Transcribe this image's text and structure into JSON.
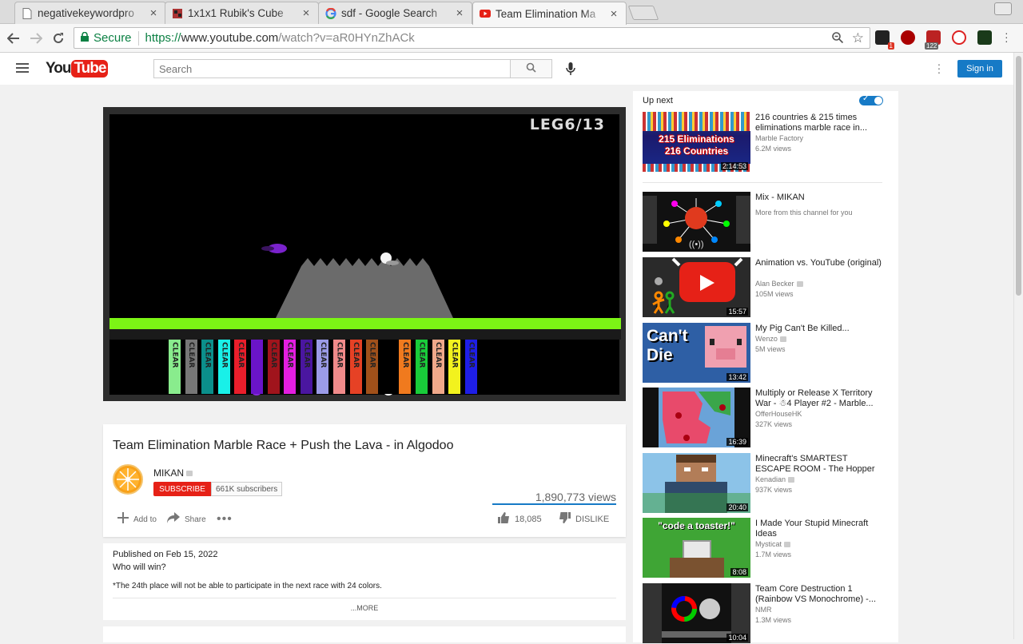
{
  "tabs": [
    {
      "title": "negativekeywordpro",
      "active": false,
      "icon": "document-icon"
    },
    {
      "title": "1x1x1 Rubik's Cube",
      "active": false,
      "icon": "cube-icon"
    },
    {
      "title": "sdf - Google Search",
      "active": false,
      "icon": "google-icon"
    },
    {
      "title": "Team Elimination Ma",
      "active": true,
      "icon": "youtube-icon"
    }
  ],
  "omnibox": {
    "secure": "Secure",
    "protocol": "https://",
    "host": "www.youtube.com",
    "path": "/watch?v=aR0HYnZhACk"
  },
  "extensions": {
    "badge_1": "1",
    "badge_2": "122"
  },
  "youtube": {
    "logo_you": "You",
    "logo_tube": "Tube",
    "search_placeholder": "Search",
    "sign_in": "Sign in"
  },
  "player": {
    "overlay_text": "LEG6/13",
    "tube_label": "CLEAR"
  },
  "video": {
    "title": "Team Elimination Marble Race + Push the Lava - in Algodoo",
    "channel": "MIKAN",
    "subscribe": "SUBSCRIBE",
    "subscribers": "661K subscribers",
    "views": "1,890,773 views",
    "add_to": "Add to",
    "share": "Share",
    "likes": "18,085",
    "dislike": "DISLIKE"
  },
  "description": {
    "published": "Published on Feb 15, 2022",
    "line1": "Who will win?",
    "line2": "*The 24th place will not be able to participate in the next race with 24 colors.",
    "more": "...MORE"
  },
  "sidebar": {
    "up_next": "Up next",
    "recommendations": [
      {
        "title": "216 countries & 215 times eliminations marble race in...",
        "channel": "Marble Factory",
        "views": "6.2M views",
        "duration": "2:14:53",
        "thumb_text_1": "215 Eliminations",
        "thumb_text_2": "216 Countries"
      },
      {
        "title": "Mix - MIKAN",
        "channel": "More from this channel for you",
        "views": "",
        "duration": ""
      },
      {
        "title": "Animation vs. YouTube (original)",
        "channel": "Alan Becker",
        "views": "105M views",
        "duration": "15:57"
      },
      {
        "title": "My Pig Can't Be Killed...",
        "channel": "Wenzo",
        "views": "5M views",
        "duration": "13:42",
        "thumb_text_1": "Can't",
        "thumb_text_2": "Die"
      },
      {
        "title": "Multiply or Release X Territory War - ☃︎4 Player #2 - Marble...",
        "channel": "OfferHouseHK",
        "views": "327K views",
        "duration": "16:39"
      },
      {
        "title": "Minecraft's SMARTEST ESCAPE ROOM - The Hopper",
        "channel": "Kenadian",
        "views": "937K views",
        "duration": "20:40"
      },
      {
        "title": "I Made Your Stupid Minecraft Ideas",
        "channel": "Mysticat",
        "views": "1.7M views",
        "duration": "8:08",
        "thumb_text_1": "\"code a toaster!\""
      },
      {
        "title": "Team Core Destruction 1 (Rainbow VS Monochrome) -...",
        "channel": "NMR",
        "views": "1.3M views",
        "duration": "10:04"
      }
    ]
  },
  "colors": {
    "youtube_red": "#e62117",
    "link_blue": "#167ac6",
    "lava_green": "#7cf415"
  }
}
